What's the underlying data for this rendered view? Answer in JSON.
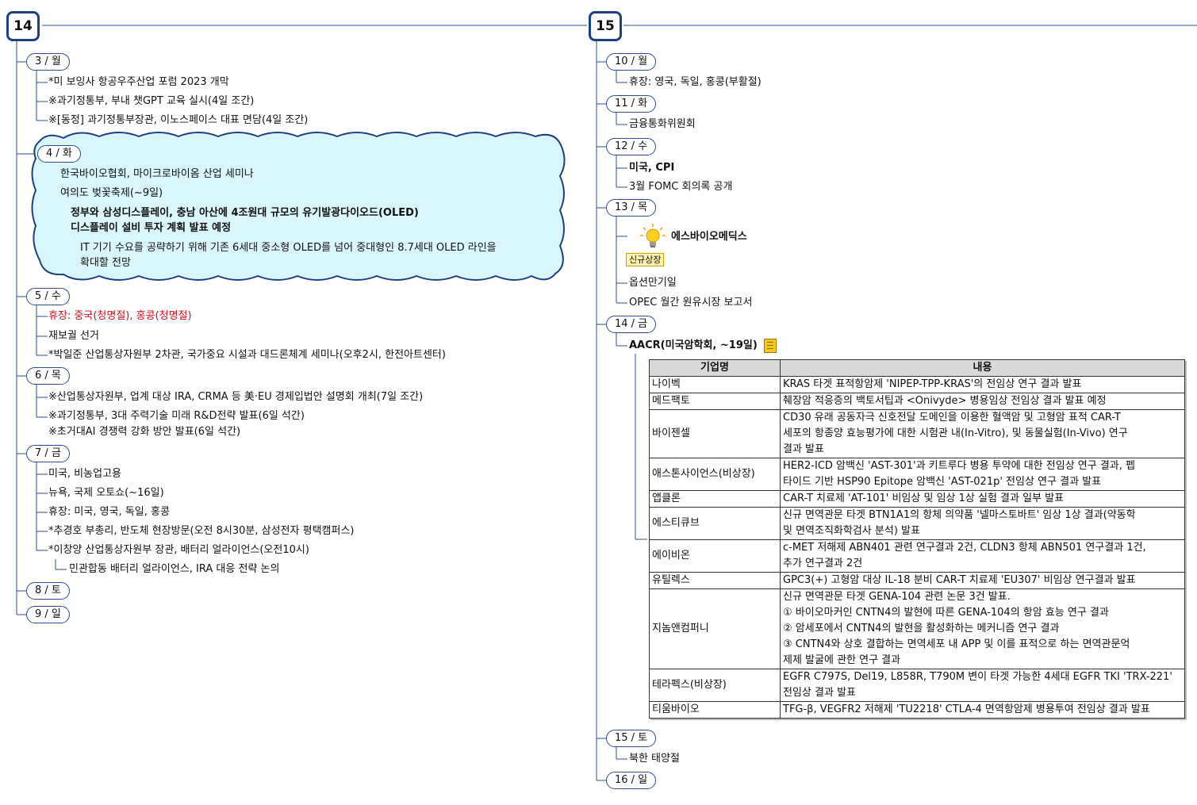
{
  "week14": {
    "number": "14",
    "days": [
      {
        "label": "3 / 월",
        "items": [
          "*미 보잉사 항공우주산업 포럼 2023 개막",
          "※과기정통부, 부내 챗GPT 교육 실시(4일 조간)",
          "※[동정] 과기정통부장관, 이노스페이스 대표 면담(4일 조간)"
        ]
      },
      {
        "label": "4 / 화",
        "items": [
          "한국바이오협회, 마이크로바이옴 산업 세미나",
          "여의도 벚꽃축제(~9일)"
        ],
        "highlight": [
          "정부와 삼성디스플레이, 충남 아산에 4조원대 규모의 유기발광다이오드(OLED)",
          "디스플레이 설비 투자 계획 발표 예정"
        ],
        "detail": [
          "IT 기기 수요를 공략하기 위해 기존 6세대 중소형 OLED를 넘어 중대형인 8.7세대 OLED 라인을",
          "확대할 전망"
        ]
      },
      {
        "label": "5 / 수",
        "items": [
          "휴장: 중국(청명절), 홍콩(청명절)",
          "재보궐 선거",
          "*박일준 산업통상자원부 2차관, 국가중요 시설과 대드론체계 세미나(오후2시, 한전아트센터)"
        ]
      },
      {
        "label": "6 / 목",
        "items": [
          "※산업통상자원부, 업계 대상 IRA, CRMA 등 美·EU 경제입법안 설명회 개최(7일 조간)",
          "※과기정통부, 3대 주력기술 미래 R&D전략 발표(6일 석간)",
          "※초거대AI 경쟁력 강화 방안 발표(6일 석간)"
        ]
      },
      {
        "label": "7 / 금",
        "items": [
          "미국, 비농업고용",
          "뉴욕, 국제 오토쇼(~16일)",
          "휴장: 미국, 영국, 독일, 홍콩",
          "*추경호 부총리, 반도체 현장방문(오전 8시30분, 삼성전자 평택캠퍼스)",
          "*이창양 산업통상자원부 장관, 배터리 얼라이언스(오전10시)",
          "민관합동 배터리 얼라이언스, IRA 대응 전략 논의"
        ]
      },
      {
        "label": "8 / 토",
        "items": []
      },
      {
        "label": "9 / 일",
        "items": []
      }
    ]
  },
  "week15": {
    "number": "15",
    "days": [
      {
        "label": "10 / 월",
        "items": [
          "휴장: 영국, 독일, 홍콩(부활절)"
        ]
      },
      {
        "label": "11 / 화",
        "items": [
          "금융통화위원회"
        ]
      },
      {
        "label": "12 / 수",
        "items": [
          "미국, CPI",
          "3월 FOMC 회의록 공개"
        ]
      },
      {
        "label": "13 / 목",
        "items": [
          "에스바이오메딕스",
          "신규상장",
          "옵션만기일",
          "OPEC 월간 원유시장 보고서"
        ]
      },
      {
        "label": "14 / 금",
        "items": [
          "AACR(미국암학회, ~19일)"
        ]
      },
      {
        "label": "15 / 토",
        "items": [
          "북한 태양절"
        ]
      },
      {
        "label": "16 / 일",
        "items": []
      }
    ]
  },
  "aacr_table": {
    "headers": [
      "기업명",
      "내용"
    ],
    "rows": [
      {
        "company": "나이벡",
        "content": [
          "KRAS 타겟 표적항암제 'NIPEP-TPP-KRAS'의 전임상 연구 결과 발표"
        ]
      },
      {
        "company": "메드팩토",
        "content": [
          "췌장암 적응증의 백토서팁과 <Onivyde> 병용임상 전임상 결과 발표 예정"
        ]
      },
      {
        "company": "바이젠셀",
        "content": [
          "CD30 유래 공동자극 신호전달 도메인을 이용한 혈액암 및 고형암 표적 CAR-T",
          "세포의 항종양 효능평가에 대한 시험관 내(In-Vitro), 및 동물실험(In-Vivo) 연구",
          "결과 발표"
        ]
      },
      {
        "company": "애스톤사이언스(비상장)",
        "content": [
          "HER2-ICD 암백신 'AST-301'과 키트루다 병용 투약에 대한 전임상 연구 결과, 펩",
          "타이드 기반 HSP90 Epitope 암백신 'AST-021p' 전임상 연구 결과 발표"
        ]
      },
      {
        "company": "앱클론",
        "content": [
          "CAR-T 치료제 'AT-101' 비임상 및 임상 1상 실험 결과 일부 발표"
        ]
      },
      {
        "company": "에스티큐브",
        "content": [
          "신규 면역관문 타겟 BTN1A1의 항체 의약품 '넬마스토바트' 임상 1상 결과(약동학",
          "및 면역조직화학검사 분석) 발표"
        ]
      },
      {
        "company": "에이비온",
        "content": [
          "c-MET 저해제 ABN401 관련 연구결과 2건, CLDN3 항체 ABN501 연구결과 1건,",
          "추가 연구결과 2건"
        ]
      },
      {
        "company": "유틸렉스",
        "content": [
          "GPC3(+) 고형암 대상 IL-18 분비 CAR-T 치료제 'EU307' 비임상 연구결과 발표"
        ]
      },
      {
        "company": "지놈앤컴퍼니",
        "content": [
          "신규 면역관문 타겟 GENA-104 관련 논문 3건 발표.",
          "① 바이오마커인 CNTN4의 발현에 따른 GENA-104의 항암 효능 연구 결과",
          "② 암세포에서 CNTN4의 발현을 활성화하는 메커니즘 연구 결과",
          "③ CNTN4와 상호 결합하는 면역세포 내 APP 및 이를 표적으로 하는 면역관문억",
          "제제 발굴에 관한 연구 결과"
        ]
      },
      {
        "company": "테라펙스(비상장)",
        "content": [
          "EGFR C797S, Del19, L858R, T790M 변이 타겟 가능한 4세대 EGFR TKI 'TRX-221'",
          "전임상 결과 발표"
        ]
      },
      {
        "company": "티움바이오",
        "content": [
          "TFG-β, VEGFR2 저해제 'TU2218' CTLA-4 면역항암제 병용투여 전임상 결과 발표"
        ]
      }
    ]
  },
  "colors": {
    "line": "#2b4d92",
    "cloud_fill": "#d9f7fb",
    "cloud_border": "#1d3f86",
    "holiday_red": "#c8161d"
  },
  "icons": [
    "lightbulb-icon",
    "note-icon"
  ]
}
